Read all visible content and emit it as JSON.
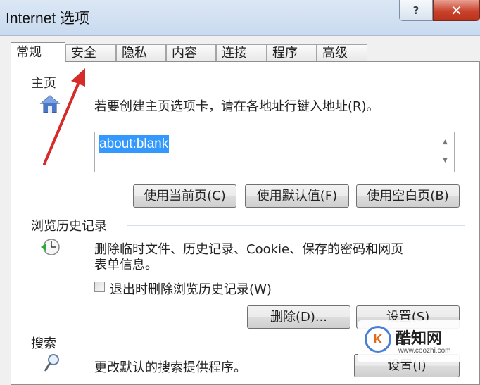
{
  "window": {
    "title": "Internet 选项",
    "help_glyph": "?",
    "close_glyph": "✕"
  },
  "tabs": [
    {
      "label": "常规",
      "active": true
    },
    {
      "label": "安全"
    },
    {
      "label": "隐私"
    },
    {
      "label": "内容"
    },
    {
      "label": "连接"
    },
    {
      "label": "程序"
    },
    {
      "label": "高级"
    }
  ],
  "homepage": {
    "group_label": "主页",
    "description": "若要创建主页选项卡，请在各地址行键入地址(R)。",
    "url_value": "about:blank",
    "buttons": [
      "使用当前页(C)",
      "使用默认值(F)",
      "使用空白页(B)"
    ]
  },
  "history": {
    "group_label": "浏览历史记录",
    "description_line1": "删除临时文件、历史记录、Cookie、保存的密码和网页",
    "description_line2": "表单信息。",
    "checkbox_label": "退出时删除浏览历史记录(W)",
    "checkbox_checked": false,
    "delete_button": "删除(D)...",
    "settings_button": "设置(S)"
  },
  "search": {
    "group_label": "搜索",
    "description": "更改默认的搜索提供程序。",
    "settings_button": "设置(I)"
  },
  "watermark": {
    "logo_text": "K",
    "name": "酷知网",
    "url": "www.coozhi.com"
  },
  "colors": {
    "selection": "#3399ff",
    "close_button": "#c9432c",
    "arrow": "#d62b2b"
  }
}
